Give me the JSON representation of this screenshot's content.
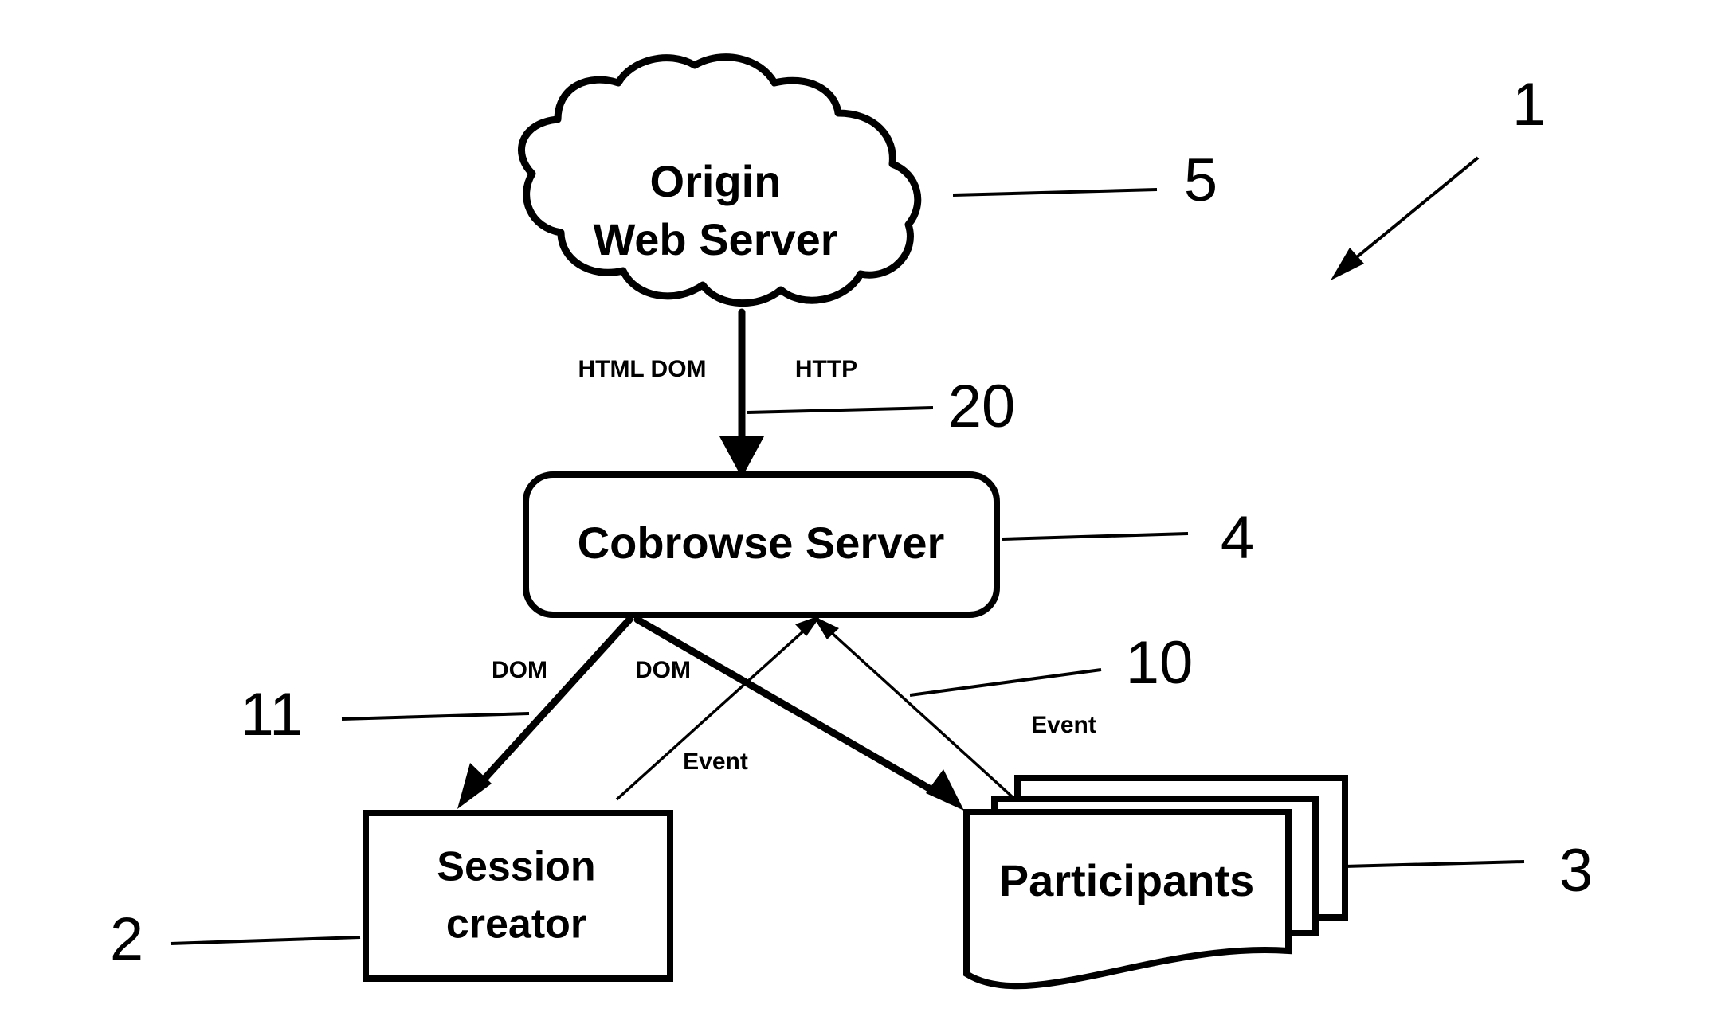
{
  "figure": {
    "title": "Cobrowse system architecture figure",
    "background_color": "#ffffff",
    "line_color": "#000000"
  },
  "nodes": {
    "origin_web_server": {
      "label_line1": "Origin",
      "label_line2": "Web Server",
      "shape": "cloud",
      "ref": "5"
    },
    "cobrowse_server": {
      "label": "Cobrowse Server",
      "shape": "rounded-rectangle",
      "ref": "4"
    },
    "session_creator": {
      "label_line1": "Session",
      "label_line2": "creator",
      "shape": "rectangle",
      "ref": "2"
    },
    "participants": {
      "label": "Participants",
      "shape": "document-stack",
      "ref": "3"
    }
  },
  "edges": [
    {
      "id": "origin-to-server",
      "labels": [
        "HTML DOM",
        "HTTP"
      ],
      "ref": "20",
      "direction": "down",
      "weight": "heavy"
    },
    {
      "id": "server-to-session",
      "labels": [
        "DOM"
      ],
      "ref": "11",
      "direction": "down-left",
      "weight": "heavy"
    },
    {
      "id": "server-to-participants",
      "labels": [
        "DOM"
      ],
      "ref": "10",
      "direction": "down-right",
      "weight": "heavy"
    },
    {
      "id": "session-to-server",
      "labels": [
        "Event"
      ],
      "ref": "",
      "direction": "up-right",
      "weight": "thin"
    },
    {
      "id": "participants-to-server",
      "labels": [
        "Event"
      ],
      "ref": "",
      "direction": "up-left",
      "weight": "thin"
    }
  ],
  "edge_labels": {
    "html_dom": "HTML DOM",
    "http": "HTTP",
    "dom_left": "DOM",
    "dom_right": "DOM",
    "event_left": "Event",
    "event_right": "Event"
  },
  "reference_numerals": {
    "figure": "1",
    "origin_web_server": "5",
    "origin_link": "20",
    "cobrowse_server": "4",
    "session_creator": "2",
    "dom_left_link": "11",
    "dom_right_link": "10",
    "participants": "3"
  }
}
